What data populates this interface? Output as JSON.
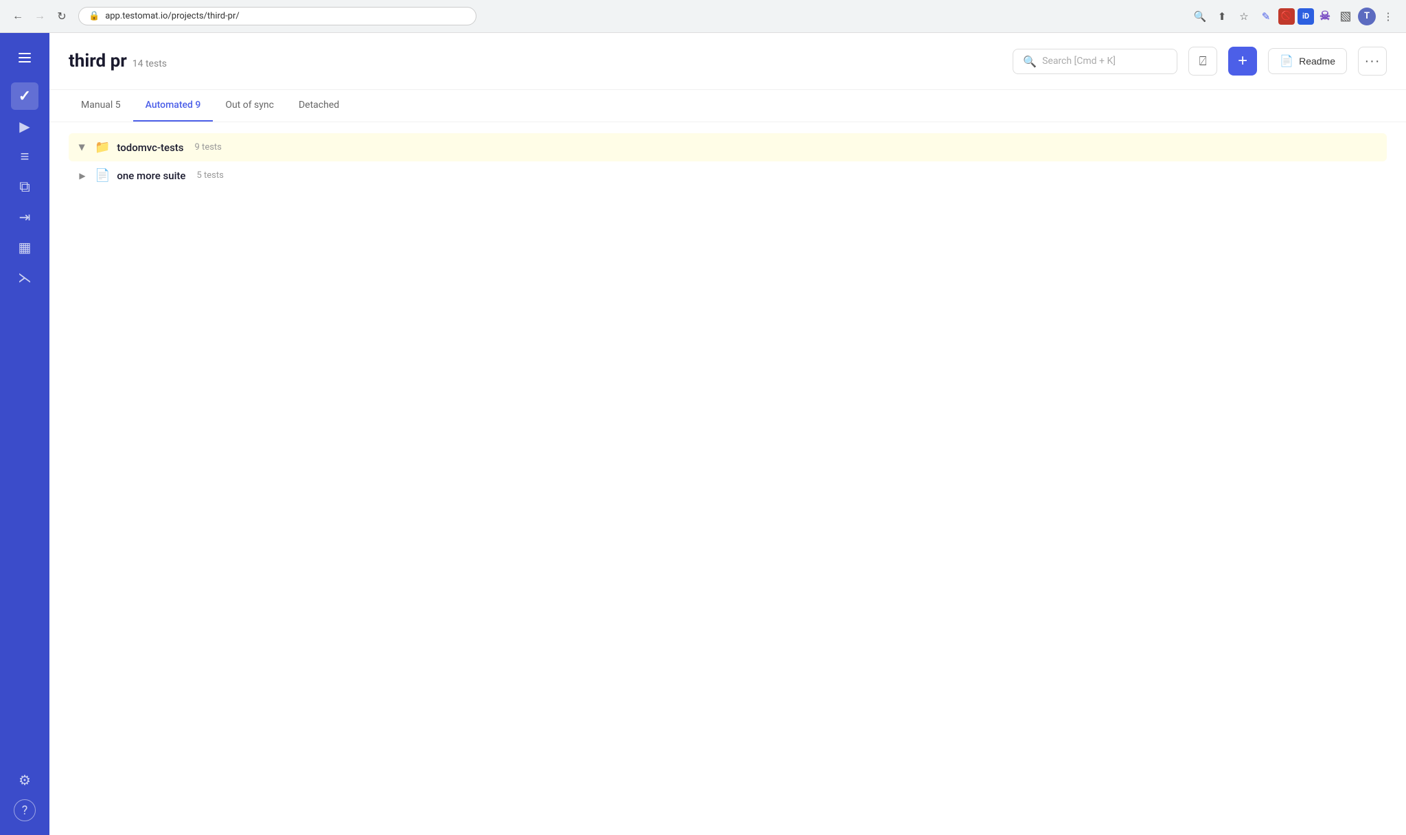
{
  "browser": {
    "url": "app.testomat.io/projects/third-pr/",
    "back_disabled": false,
    "forward_disabled": true
  },
  "header": {
    "project_title": "third pr",
    "test_count": "14 tests",
    "search_placeholder": "Search [Cmd + K]",
    "readme_label": "Readme",
    "add_label": "+",
    "more_label": "···"
  },
  "tabs": [
    {
      "id": "manual",
      "label": "Manual 5",
      "active": false
    },
    {
      "id": "automated",
      "label": "Automated 9",
      "active": true
    },
    {
      "id": "out-of-sync",
      "label": "Out of sync",
      "active": false
    },
    {
      "id": "detached",
      "label": "Detached",
      "active": false
    }
  ],
  "suites": [
    {
      "id": "todomvc-tests",
      "name": "todomvc-tests",
      "count": "9 tests",
      "type": "folder",
      "expanded": true,
      "highlighted": true
    },
    {
      "id": "one-more-suite",
      "name": "one more suite",
      "count": "5 tests",
      "type": "file",
      "expanded": false,
      "highlighted": false
    }
  ],
  "sidebar": {
    "items": [
      {
        "id": "check",
        "icon": "✓",
        "active": true
      },
      {
        "id": "play",
        "icon": "▶",
        "active": false
      },
      {
        "id": "list",
        "icon": "≡",
        "active": false
      },
      {
        "id": "layers",
        "icon": "◈",
        "active": false
      },
      {
        "id": "import",
        "icon": "⇥",
        "active": false
      },
      {
        "id": "chart",
        "icon": "▦",
        "active": false
      },
      {
        "id": "git",
        "icon": "⎇",
        "active": false
      }
    ],
    "bottom": [
      {
        "id": "settings",
        "icon": "⚙"
      },
      {
        "id": "help",
        "icon": "?"
      }
    ]
  }
}
